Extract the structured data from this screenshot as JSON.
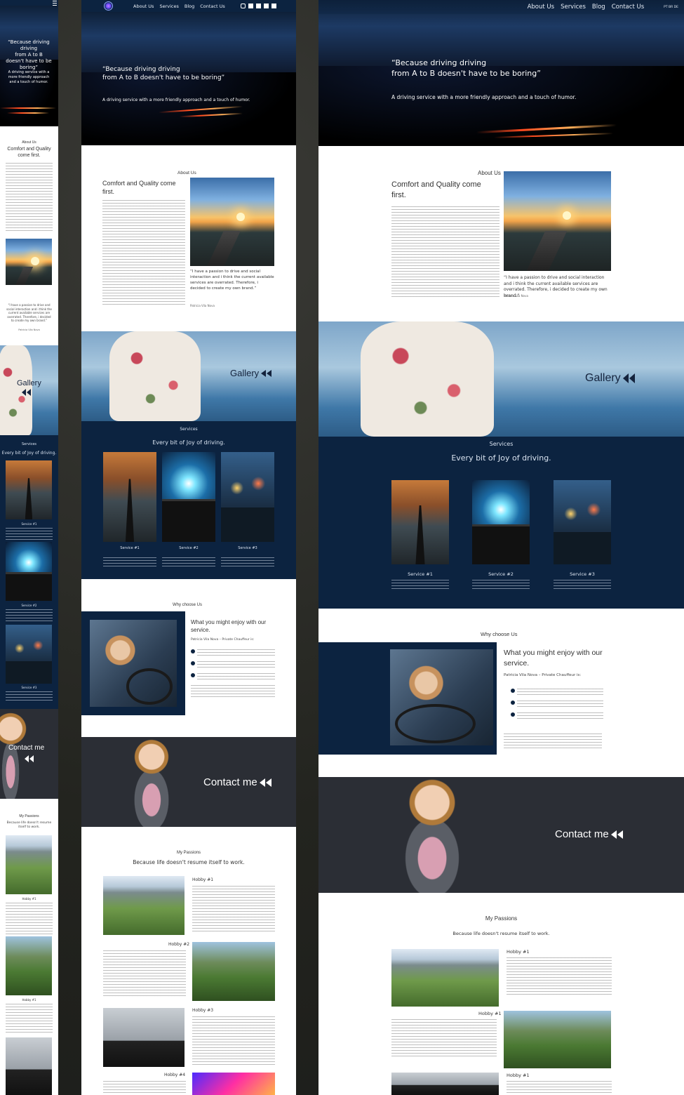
{
  "nav": {
    "links": [
      "About Us",
      "Services",
      "Blog",
      "Contact Us"
    ],
    "lang": "PT BR DE"
  },
  "hero": {
    "quote_desktop": "“Because driving driving\nfrom A to B doesn't have to be boring”",
    "quote_mobile": "“Because driving driving\nfrom A to B doesn't have to be boring”",
    "subtitle": "A driving service with a more friendly approach and a touch of humor.",
    "subtitle_mobile": "A driving service with a more friendly approach and a touch of humor."
  },
  "about": {
    "label": "About Us",
    "heading": "Comfort and Quality come first.",
    "quote": "“I have a passion to drive and social interaction and i think the current available services are overrated. Therefore, i decided to create my own brand.”",
    "author": "Patricia Vila Nova"
  },
  "gallery": {
    "label": "Gallery"
  },
  "services": {
    "label": "Services",
    "heading": "Every bit of Joy of driving.",
    "items": [
      "Service #1",
      "Service #2",
      "Service #3"
    ]
  },
  "why": {
    "label": "Why choose Us",
    "heading": "What you might enjoy with our service.",
    "byline": "Patricia Vila Nova – Private Chauffeur is:"
  },
  "contact": {
    "label": "Contact me"
  },
  "passions": {
    "label": "My Passions",
    "heading": "Because life doesn't resume itself to work.",
    "hobbies": [
      "Hobby #1",
      "Hobby #2",
      "Hobby #3",
      "Hobby #4"
    ],
    "hobbies_desktop": [
      "Hobby #1",
      "Hobby #1",
      "Hobby #1"
    ]
  }
}
